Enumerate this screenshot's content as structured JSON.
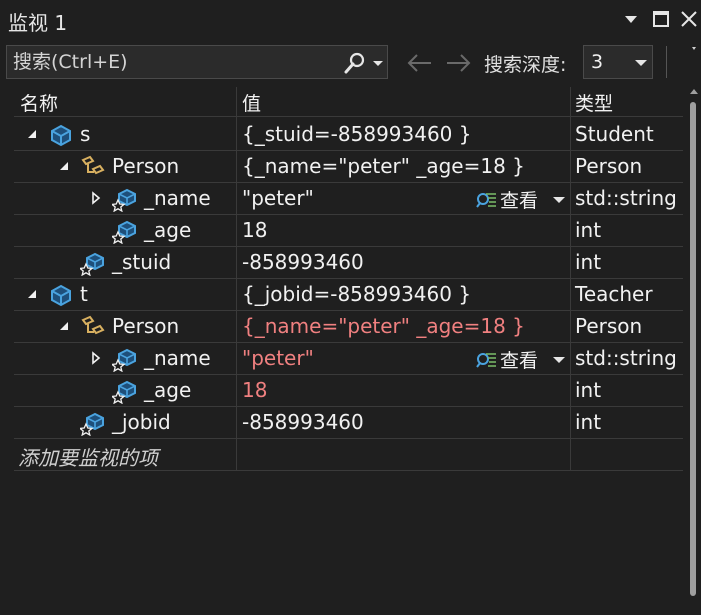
{
  "window": {
    "title": "监视 1",
    "pin_icon": "dropdown-arrow-icon",
    "maximize_icon": "maximize-icon",
    "close_icon": "close-icon"
  },
  "toolbar": {
    "search_placeholder": "搜索(Ctrl+E)",
    "search_icon": "search-icon",
    "back_icon": "arrow-left-icon",
    "forward_icon": "arrow-right-icon",
    "depth_label": "搜索深度:",
    "depth_value": "3"
  },
  "columns": {
    "name": "名称",
    "value": "值",
    "type": "类型"
  },
  "rows": [
    {
      "name": "s",
      "value": "{_stuid=-858993460 }",
      "type": "Student",
      "indent": 0,
      "expander": "expanded",
      "icon": "variable-icon",
      "changed": false,
      "view": ""
    },
    {
      "name": "Person",
      "value": "{_name=\"peter\" _age=18 }",
      "type": "Person",
      "indent": 1,
      "expander": "expanded",
      "icon": "base-class-icon",
      "changed": false,
      "view": ""
    },
    {
      "name": "_name",
      "value": "\"peter\"",
      "type": "std::string",
      "indent": 2,
      "expander": "collapsed",
      "icon": "protected-field-icon",
      "changed": false,
      "view": "查看"
    },
    {
      "name": "_age",
      "value": "18",
      "type": "int",
      "indent": 2,
      "expander": "none",
      "icon": "protected-field-icon",
      "changed": false,
      "view": ""
    },
    {
      "name": "_stuid",
      "value": "-858993460",
      "type": "int",
      "indent": 1,
      "expander": "none",
      "icon": "protected-field-icon",
      "changed": false,
      "view": ""
    },
    {
      "name": "t",
      "value": "{_jobid=-858993460 }",
      "type": "Teacher",
      "indent": 0,
      "expander": "expanded",
      "icon": "variable-icon",
      "changed": false,
      "view": ""
    },
    {
      "name": "Person",
      "value": "{_name=\"peter\" _age=18 }",
      "type": "Person",
      "indent": 1,
      "expander": "expanded",
      "icon": "base-class-icon",
      "changed": true,
      "view": ""
    },
    {
      "name": "_name",
      "value": "\"peter\"",
      "type": "std::string",
      "indent": 2,
      "expander": "collapsed",
      "icon": "protected-field-icon",
      "changed": true,
      "view": "查看"
    },
    {
      "name": "_age",
      "value": "18",
      "type": "int",
      "indent": 2,
      "expander": "none",
      "icon": "protected-field-icon",
      "changed": true,
      "view": ""
    },
    {
      "name": "_jobid",
      "value": "-858993460",
      "type": "int",
      "indent": 1,
      "expander": "none",
      "icon": "protected-field-icon",
      "changed": false,
      "view": ""
    }
  ],
  "add_item_placeholder": "添加要监视的项",
  "colors": {
    "background": "#1f1f1f",
    "changed_value": "#f08080",
    "icon_blue": "#4aa3df",
    "icon_gold": "#d8b060"
  }
}
